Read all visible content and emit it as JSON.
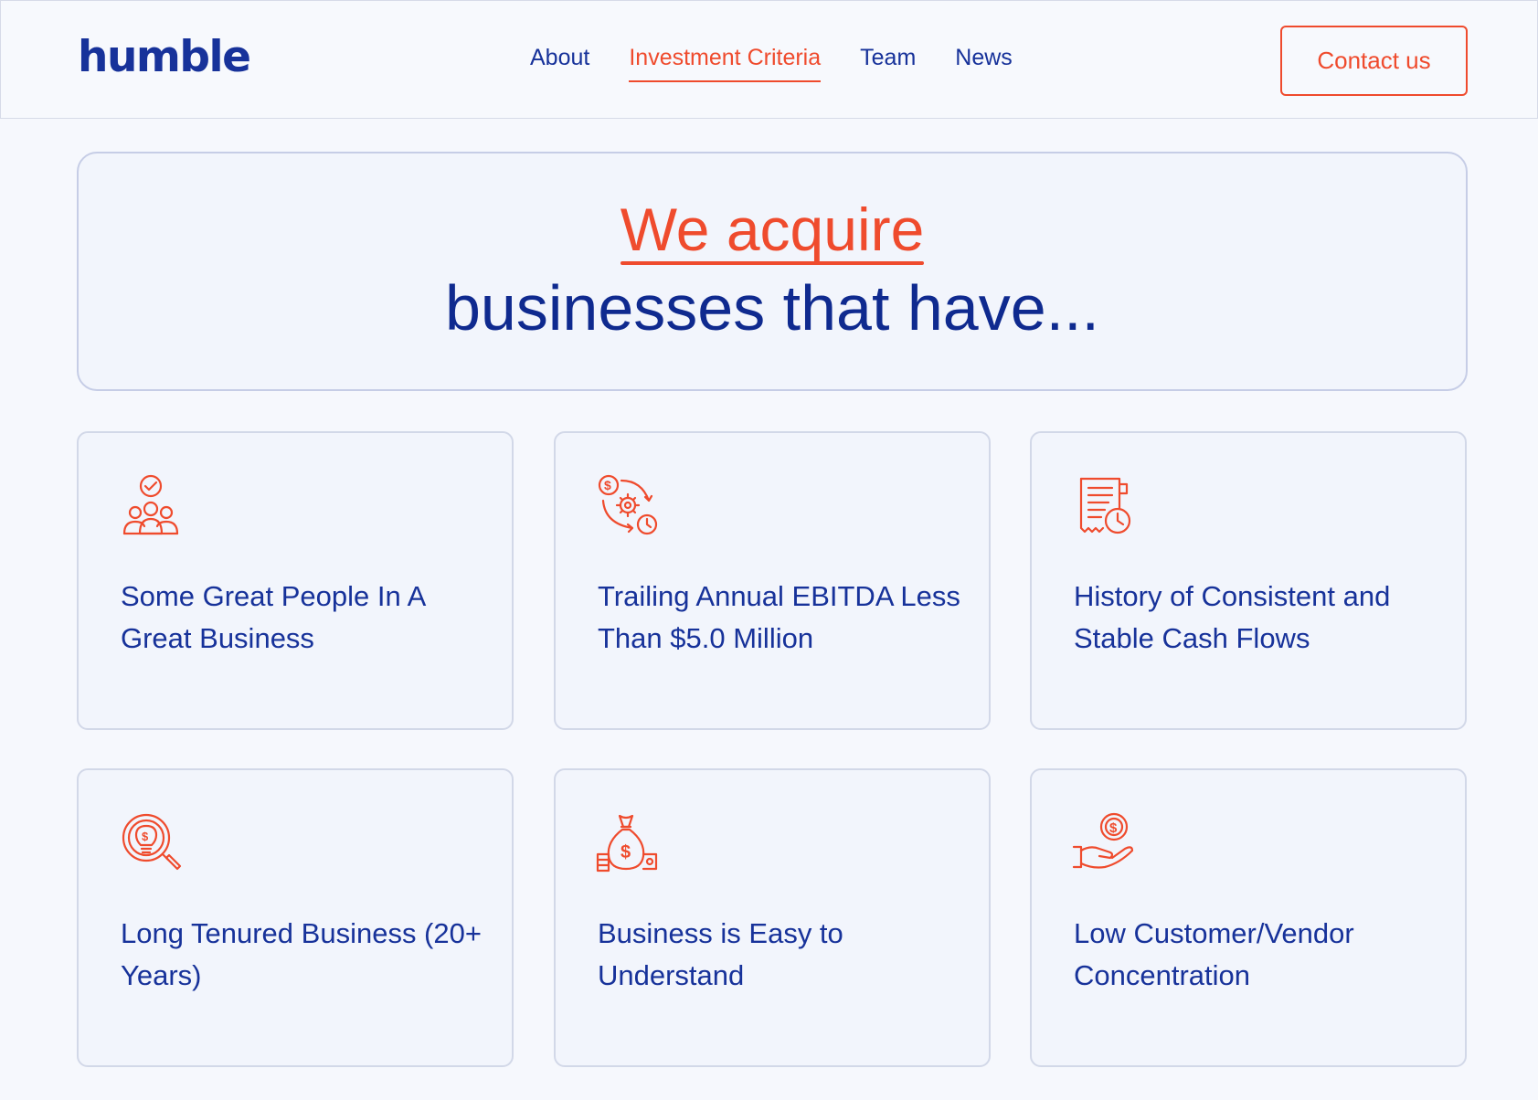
{
  "header": {
    "logo": "humble",
    "nav": [
      {
        "label": "About",
        "active": false
      },
      {
        "label": "Investment Criteria",
        "active": true
      },
      {
        "label": "Team",
        "active": false
      },
      {
        "label": "News",
        "active": false
      }
    ],
    "contact_label": "Contact us"
  },
  "hero": {
    "line1": "We acquire",
    "line2": "businesses that have..."
  },
  "cards": [
    {
      "icon": "team-check-icon",
      "text": "Some Great People In A Great Business"
    },
    {
      "icon": "money-gear-clock-icon",
      "text": "Trailing Annual EBITDA Less Than $5.0 Million"
    },
    {
      "icon": "receipt-clock-icon",
      "text": "History of Consistent and Stable Cash Flows"
    },
    {
      "icon": "lightbulb-magnifier-icon",
      "text": "Long Tenured Business (20+ Years)"
    },
    {
      "icon": "money-bag-icon",
      "text": "Business is Easy to Understand"
    },
    {
      "icon": "hand-coin-icon",
      "text": "Low Customer/Vendor Concentration"
    }
  ],
  "colors": {
    "accent": "#ef4b2d",
    "brand": "#17329a",
    "background": "#f6f8fd"
  }
}
